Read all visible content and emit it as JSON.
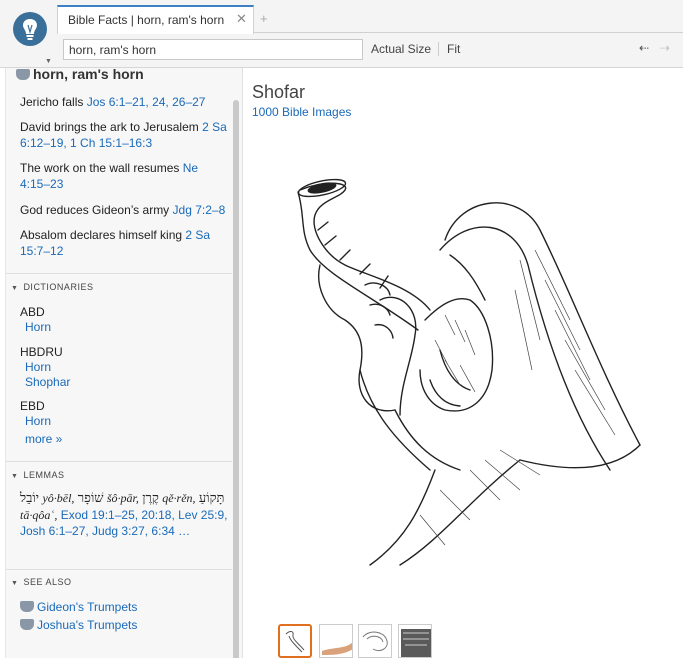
{
  "tab": {
    "title": "Bible Facts | horn, ram's horn",
    "close_glyph": "✕",
    "add_glyph": "+"
  },
  "toolbar": {
    "search_value": "horn, ram's horn",
    "actual_size": "Actual Size",
    "fit": "Fit",
    "back_glyph": "⇠",
    "forward_glyph": "⇢"
  },
  "sidebar": {
    "topic": "horn, ram's horn",
    "events": [
      {
        "text": "Jericho falls ",
        "ref": "Jos 6:1–21, 24, 26–27"
      },
      {
        "text": "David brings the ark to Jerusalem ",
        "ref": "2 Sa 6:12–19, 1 Ch 15:1–16:3"
      },
      {
        "text": "The work on the wall resumes ",
        "ref": "Ne 4:15–23"
      },
      {
        "text": "God reduces Gideon’s army ",
        "ref": "Jdg 7:2–8"
      },
      {
        "text": "Absalom declares himself king ",
        "ref": "2 Sa 15:7–12"
      }
    ],
    "dictionaries_header": "DICTIONARIES",
    "dictionaries": [
      {
        "abbr": "ABD",
        "links": [
          "Horn"
        ]
      },
      {
        "abbr": "HBDRU",
        "links": [
          "Horn",
          "Shophar"
        ]
      },
      {
        "abbr": "EBD",
        "links": [
          "Horn"
        ]
      }
    ],
    "more": "more »",
    "lemmas_header": "LEMMAS",
    "lemmas": {
      "heb1": "יוֹבֵל",
      "tr1": "yô·bēl,",
      "heb2": "שׁוֹפָר",
      "tr2": "šô·pār,",
      "heb3": "קֶרֶן",
      "tr3": "qě·rěn,",
      "heb4": "תָּקוֹעַ",
      "tr4": "tā·qôaʿ,",
      "refs": "Exod 19:1–25, 20:18, Lev 25:9, Josh 6:1–27, Judg 3:27, 6:34 …"
    },
    "see_also_header": "SEE ALSO",
    "see_also": [
      "Gideon's Trumpets",
      "Joshua's Trumpets"
    ]
  },
  "main": {
    "title": "Shofar",
    "images_link": "1000 Bible Images"
  },
  "colors": {
    "link": "#1a6ab8",
    "accent": "#3b80c2",
    "thumb_selected": "#e06f1f"
  }
}
